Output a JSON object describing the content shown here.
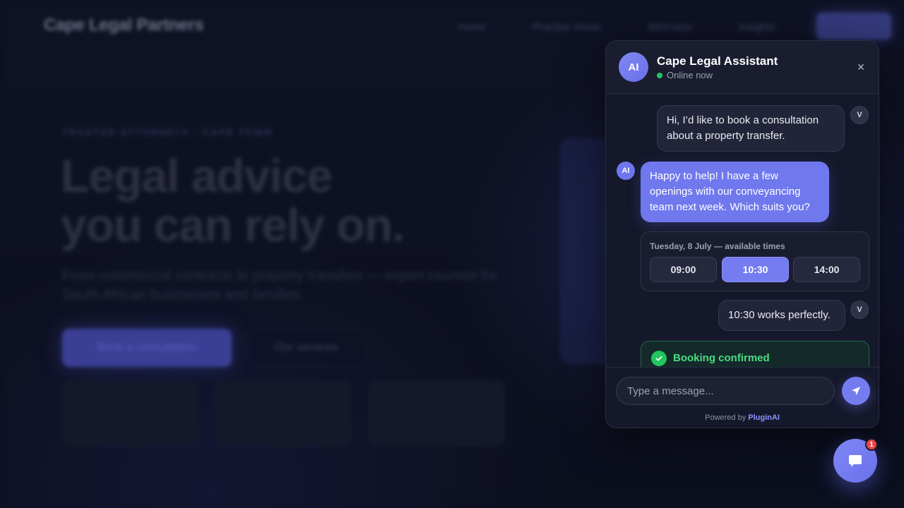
{
  "site": {
    "brand": "Cape Legal Partners",
    "nav": [
      "Home",
      "Practice Areas",
      "Attorneys",
      "Insights"
    ],
    "nav_cta": "Contact",
    "eyebrow": "TRUSTED ATTORNEYS · CAPE TOWN",
    "hero_title_line1": "Legal advice",
    "hero_title_line2": "you can rely on.",
    "hero_subtitle": "From commercial contracts to property transfers — expert counsel for South African businesses and families.",
    "primary_cta": "Book a consultation",
    "secondary_cta": "Our services"
  },
  "chat": {
    "avatar": "AI",
    "title": "Cape Legal Assistant",
    "status": "Online now",
    "close_icon": "×",
    "user_avatar": "V",
    "ai_avatar": "AI",
    "messages": {
      "user_1": "Hi, I’d like to book a consultation about a property transfer.",
      "ai_1": "Happy to help! I have a few openings with our conveyancing team next week. Which suits you?",
      "user_2": "10:30 works perfectly."
    },
    "slots": {
      "label": "Tuesday, 8 July — available times",
      "times": [
        "09:00",
        "10:30",
        "14:00"
      ],
      "selected": "10:30"
    },
    "confirmation": {
      "title": "Booking confirmed"
    },
    "input_placeholder": "Type a message...",
    "powered_prefix": "Powered by",
    "powered_brand": "PluginAI"
  },
  "launcher": {
    "badge_count": "1"
  },
  "colors": {
    "accent": "#747cf0",
    "online": "#22c55e",
    "confirm": "#4ade80",
    "badge": "#ef4444"
  }
}
